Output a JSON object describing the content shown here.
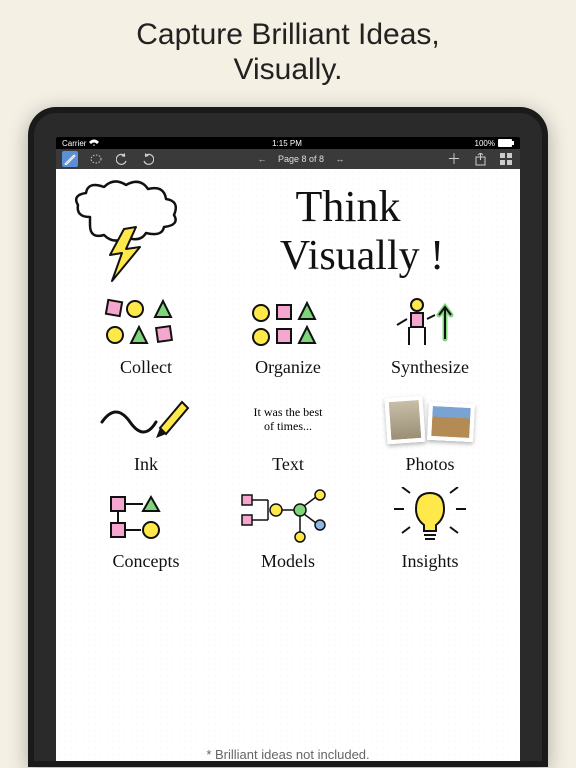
{
  "marketing": {
    "headline_l1": "Capture Brilliant Ideas,",
    "headline_l2": "Visually.",
    "footnote": "* Brilliant ideas not included."
  },
  "statusbar": {
    "carrier": "Carrier",
    "time": "1:15 PM",
    "battery": "100%"
  },
  "toolbar": {
    "page_label": "Page 8 of 8"
  },
  "canvas": {
    "title_l1": "Think",
    "title_l2": "Visually !",
    "row1": {
      "a": "Collect",
      "b": "Organize",
      "c": "Synthesize"
    },
    "row2": {
      "a": "Ink",
      "b_body": "It was the best of times...",
      "b": "Text",
      "c": "Photos"
    },
    "row3": {
      "a": "Concepts",
      "b": "Models",
      "c": "Insights"
    }
  }
}
